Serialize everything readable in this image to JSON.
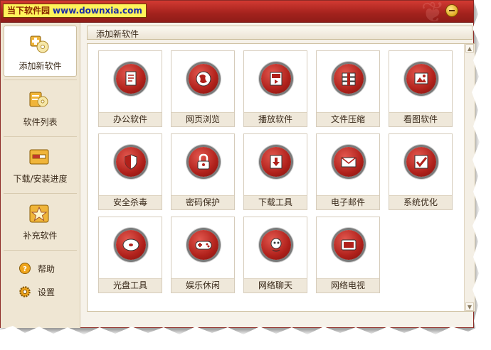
{
  "app": {
    "logo_text": "当下软件园",
    "logo_url": "www.downxia.com"
  },
  "titlebar": {
    "minimize_icon": "minimize-icon"
  },
  "sidebar": {
    "nav": [
      {
        "label": "添加新软件",
        "icon": "add-software-icon",
        "active": true
      },
      {
        "label": "软件列表",
        "icon": "software-list-icon",
        "active": false
      },
      {
        "label": "下载/安装进度",
        "icon": "download-progress-icon",
        "active": false
      },
      {
        "label": "补充软件",
        "icon": "star-icon",
        "active": false
      }
    ],
    "utilities": [
      {
        "label": "帮助",
        "icon": "help-icon"
      },
      {
        "label": "设置",
        "icon": "gear-icon"
      }
    ]
  },
  "main": {
    "header": "添加新软件",
    "categories": [
      {
        "label": "办公软件",
        "icon": "office-icon"
      },
      {
        "label": "网页浏览",
        "icon": "browser-globe-icon"
      },
      {
        "label": "播放软件",
        "icon": "player-icon"
      },
      {
        "label": "文件压缩",
        "icon": "archive-icon"
      },
      {
        "label": "看图软件",
        "icon": "image-viewer-icon"
      },
      {
        "label": "安全杀毒",
        "icon": "shield-icon"
      },
      {
        "label": "密码保护",
        "icon": "lock-icon"
      },
      {
        "label": "下载工具",
        "icon": "download-icon"
      },
      {
        "label": "电子邮件",
        "icon": "email-icon"
      },
      {
        "label": "系统优化",
        "icon": "system-optimize-icon"
      },
      {
        "label": "光盘工具",
        "icon": "disc-icon"
      },
      {
        "label": "娱乐休闲",
        "icon": "gamepad-icon"
      },
      {
        "label": "网络聊天",
        "icon": "chat-icon"
      },
      {
        "label": "网络电视",
        "icon": "tv-icon"
      }
    ]
  },
  "colors": {
    "titlebar": "#b3261f",
    "accent": "#b0211b",
    "background": "#f6f2ea",
    "logo_bg": "#fff35a"
  }
}
